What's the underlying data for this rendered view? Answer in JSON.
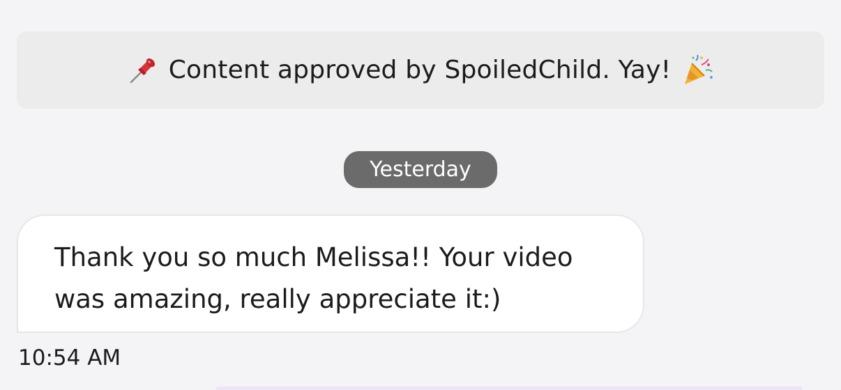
{
  "banner": {
    "pin_icon": "pushpin-icon",
    "text": "Content approved by SpoiledChild. Yay!",
    "party_icon": "party-popper-icon"
  },
  "date_separator": {
    "label": "Yesterday"
  },
  "message": {
    "text": "Thank you so much Melissa!! Your video was amazing, really appreciate it:)",
    "time": "10:54 AM"
  },
  "colors": {
    "background": "#f4f4f6",
    "banner": "#ececed",
    "pill": "#6b6b6b",
    "bubble": "#ffffff",
    "text": "#1b1b1d"
  }
}
